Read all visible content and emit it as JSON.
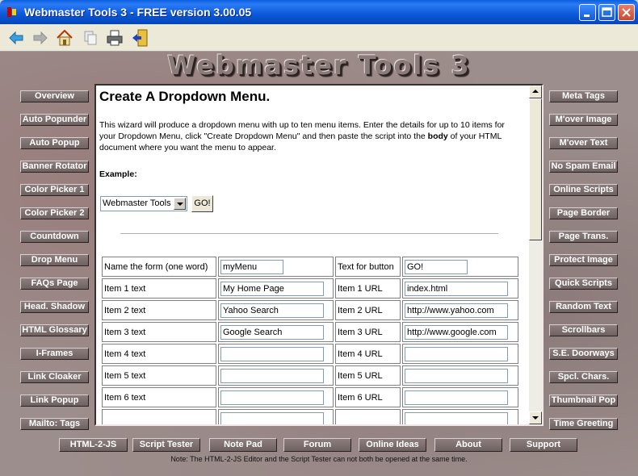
{
  "window": {
    "title": "Webmaster Tools 3 - FREE version 3.00.05"
  },
  "toolbar": {
    "icons": [
      "back-arrow-icon",
      "forward-arrow-icon",
      "home-icon",
      "copy-icon",
      "print-icon",
      "exit-door-icon"
    ]
  },
  "logo": "Webmaster Tools 3",
  "left_nav": [
    "Overview",
    "Auto Popunder",
    "Auto Popup",
    "Banner Rotator",
    "Color Picker 1",
    "Color Picker 2",
    "Countdown",
    "Drop Menu",
    "FAQs Page",
    "Head. Shadow",
    "HTML Glossary",
    "I-Frames",
    "Link Cloaker",
    "Link Popup",
    "Mailto: Tags"
  ],
  "right_nav": [
    "Meta Tags",
    "M'over Image",
    "M'over Text",
    "No Spam Email",
    "Online Scripts",
    "Page Border",
    "Page Trans.",
    "Protect Image",
    "Quick Scripts",
    "Random Text",
    "Scrollbars",
    "S.E. Doorways",
    "Spcl. Chars.",
    "Thumbnail Pop",
    "Time Greeting"
  ],
  "bottom_nav": [
    "HTML-2-JS",
    "Script Tester",
    "Note Pad",
    "Forum",
    "Online Ideas",
    "About",
    "Support"
  ],
  "note": "Note: The HTML-2-JS Editor and the Script Tester can not both be opened at the same time.",
  "content": {
    "heading": "Create A Dropdown Menu.",
    "para_a": "This wizard will produce a dropdown menu with up to ten menu items. Enter the details for up to 10 items for your Dropdown Menu, click \"Create Dropdown Menu\" and then paste the script into the ",
    "para_bold": "body",
    "para_b": " of your HTML document where you want the menu to appear.",
    "example_label": "Example:",
    "example_select": "Webmaster Tools",
    "example_go": "GO!",
    "form": {
      "rows": [
        {
          "label1": "Name the form (one word)",
          "value1": "myMenu",
          "label2": "Text for button",
          "value2": "GO!"
        },
        {
          "label1": "Item 1 text",
          "value1": "My Home Page",
          "label2": "Item 1 URL",
          "value2": "index.html"
        },
        {
          "label1": "Item 2 text",
          "value1": "Yahoo Search",
          "label2": "Item 2 URL",
          "value2": "http://www.yahoo.com"
        },
        {
          "label1": "Item 3 text",
          "value1": "Google Search",
          "label2": "Item 3 URL",
          "value2": "http://www.google.com"
        },
        {
          "label1": "Item 4 text",
          "value1": "",
          "label2": "Item 4 URL",
          "value2": ""
        },
        {
          "label1": "Item 5 text",
          "value1": "",
          "label2": "Item 5 URL",
          "value2": ""
        },
        {
          "label1": "Item 6 text",
          "value1": "",
          "label2": "Item 6 URL",
          "value2": ""
        },
        {
          "label1": "",
          "value1": "",
          "label2": "",
          "value2": ""
        }
      ]
    }
  }
}
